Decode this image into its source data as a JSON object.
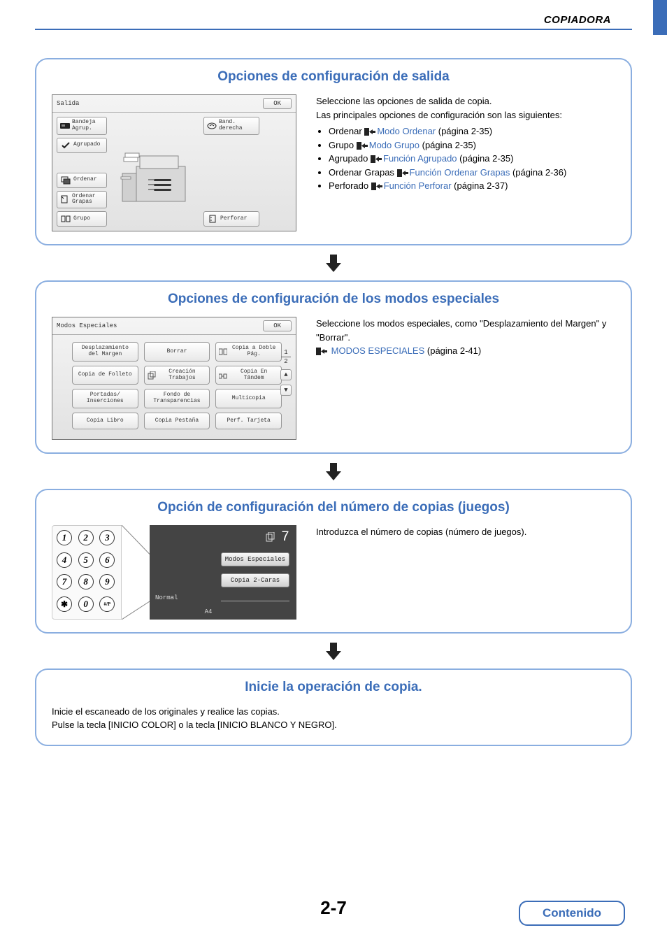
{
  "header": {
    "title": "COPIADORA"
  },
  "page_number": "2-7",
  "contenido_label": "Contenido",
  "steps": {
    "salida": {
      "title": "Opciones de configuración de salida",
      "intro1": "Seleccione las opciones de salida de copia.",
      "intro2": "Las principales opciones de configuración son las siguientes:",
      "items": [
        {
          "prefix": "Ordenar ",
          "link": "Modo Ordenar",
          "suffix": " (página 2-35)"
        },
        {
          "prefix": "Grupo ",
          "link": "Modo Grupo",
          "suffix": " (página 2-35)"
        },
        {
          "prefix": "Agrupado ",
          "link": "Función Agrupado",
          "suffix": " (página 2-35)"
        },
        {
          "prefix": "Ordenar Grapas ",
          "link": "Función Ordenar Grapas",
          "suffix": " (página 2-36)"
        },
        {
          "prefix": "Perforado ",
          "link": "Función Perforar",
          "suffix": " (página 2-37)"
        }
      ],
      "panel": {
        "title": "Salida",
        "ok": "OK",
        "left": [
          {
            "label": "Bandeja Agrup."
          },
          {
            "label": "Agrupado"
          },
          {
            "label": "Ordenar"
          },
          {
            "label": "Ordenar Grapas"
          },
          {
            "label": "Grupo"
          }
        ],
        "right": [
          {
            "label": "Band. derecha"
          },
          {
            "label": "Perforar"
          }
        ]
      }
    },
    "modos": {
      "title": "Opciones de configuración de los modos especiales",
      "intro": "Seleccione los modos especiales, como \"Desplazamiento del Margen\" y \"Borrar\".",
      "link": "MODOS ESPECIALES",
      "link_suffix": " (página 2-41)",
      "panel": {
        "title": "Modos Especiales",
        "ok": "OK",
        "page_num": "1",
        "page_den": "2",
        "buttons": [
          "Desplazamiento del Margen",
          "Borrar",
          "Copia a Doble Pág.",
          "Copia de Folleto",
          "Creación Trabajos",
          "Copia En Tándem",
          "Portadas/ Inserciones",
          "Fondo de Transparencias",
          "Multicopia",
          "Copia Libro",
          "Copia Pestaña",
          "Perf. Tarjeta"
        ]
      }
    },
    "copias": {
      "title": "Opción de configuración del número de copias (juegos)",
      "intro": "Introduzca el número de copias (número de juegos).",
      "panel": {
        "count": "7",
        "modos_especiales": "Modos Especiales",
        "copia_2caras": "Copia 2-Caras",
        "normal": "Normal",
        "a4": "A4",
        "keys": [
          "1",
          "2",
          "3",
          "4",
          "5",
          "6",
          "7",
          "8",
          "9",
          "✱",
          "0",
          "#/P"
        ]
      }
    },
    "inicio": {
      "title": "Inicie la operación de copia.",
      "line1": "Inicie el escaneado de los originales y realice las copias.",
      "line2": "Pulse la tecla [INICIO COLOR] o la tecla [INICIO BLANCO Y NEGRO]."
    }
  }
}
